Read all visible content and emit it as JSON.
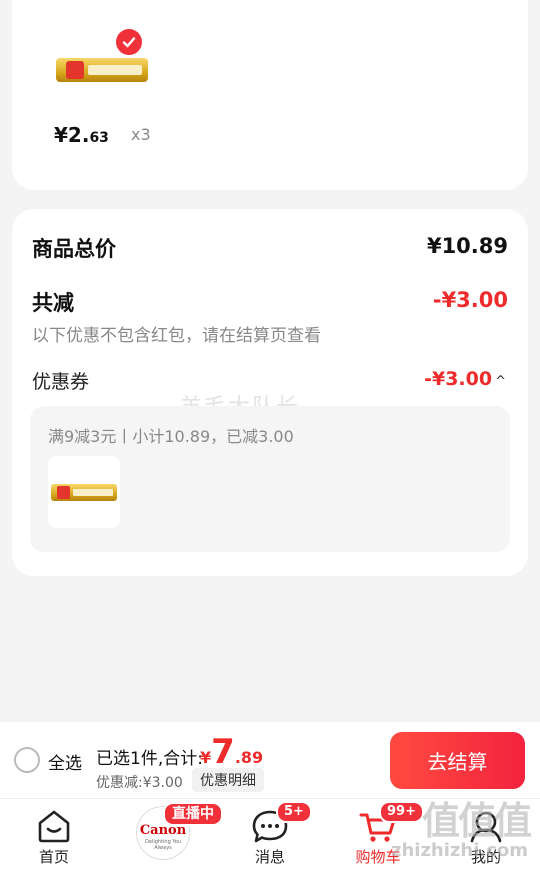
{
  "product": {
    "price_main": "¥2.",
    "price_cents": "63",
    "quantity": "x3",
    "selected_icon": "check-icon"
  },
  "summary": {
    "total_label": "商品总价",
    "total_value": "¥10.89",
    "reduce_label": "共减",
    "reduce_value": "-¥3.00",
    "reduce_note": "以下优惠不包含红包，请在结算页查看",
    "coupon_label": "优惠券",
    "coupon_value": "-¥3.00",
    "coupon_caret": "^",
    "coupon_desc": "满9减3元丨小计10.89，已减3.00"
  },
  "watermark": "羊毛大队长",
  "checkout": {
    "select_all": "全选",
    "selected_text": "已选1件,合计:",
    "total_yen": "¥",
    "total_int": "7",
    "total_dec": ".89",
    "discount_text": "优惠减:¥3.00",
    "detail_button": "优惠明细",
    "checkout_button": "去结算"
  },
  "tabbar": {
    "home": "首页",
    "live_badge": "直播中",
    "live_brand": "Canon",
    "live_tagline": "Delighting You Always",
    "messages": "消息",
    "messages_badge": "5+",
    "cart": "购物车",
    "cart_badge": "99+",
    "mine": "我的"
  },
  "site_watermark": {
    "logo": "值值值",
    "url": "zhizhizhi.com"
  },
  "colors": {
    "accent": "#ee2a2a",
    "checkout_gradient_start": "#ff4a3f",
    "checkout_gradient_end": "#f2233e"
  }
}
